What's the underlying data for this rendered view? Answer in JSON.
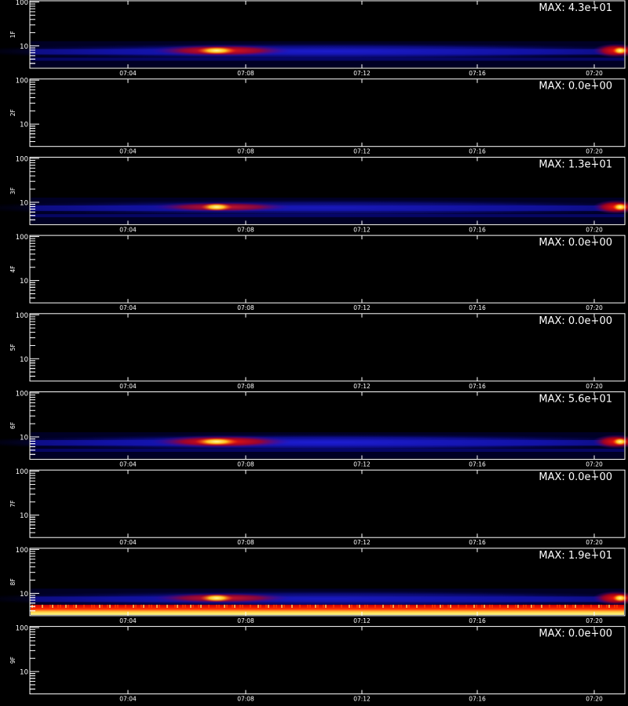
{
  "chart_data": [
    {
      "type": "heatmap",
      "ylabel": "1F",
      "max_label": "MAX: 4.3e+01",
      "y_tick_labels": [
        "100",
        "10"
      ],
      "x_tick_labels": [
        "07:04",
        "07:08",
        "07:12",
        "07:16",
        "07:20"
      ],
      "yscale": "log",
      "active": true,
      "max_value": 43
    },
    {
      "type": "heatmap",
      "ylabel": "2F",
      "max_label": "MAX: 0.0e+00",
      "y_tick_labels": [
        "100",
        "10"
      ],
      "x_tick_labels": [
        "07:04",
        "07:08",
        "07:12",
        "07:16",
        "07:20"
      ],
      "yscale": "log",
      "active": false,
      "max_value": 0
    },
    {
      "type": "heatmap",
      "ylabel": "3F",
      "max_label": "MAX: 1.3e+01",
      "y_tick_labels": [
        "100",
        "10"
      ],
      "x_tick_labels": [
        "07:04",
        "07:08",
        "07:12",
        "07:16",
        "07:20"
      ],
      "yscale": "log",
      "active": true,
      "max_value": 13
    },
    {
      "type": "heatmap",
      "ylabel": "4F",
      "max_label": "MAX: 0.0e+00",
      "y_tick_labels": [
        "100",
        "10"
      ],
      "x_tick_labels": [
        "07:04",
        "07:08",
        "07:12",
        "07:16",
        "07:20"
      ],
      "yscale": "log",
      "active": false,
      "max_value": 0
    },
    {
      "type": "heatmap",
      "ylabel": "5F",
      "max_label": "MAX: 0.0e+00",
      "y_tick_labels": [
        "100",
        "10"
      ],
      "x_tick_labels": [
        "07:04",
        "07:08",
        "07:12",
        "07:16",
        "07:20"
      ],
      "yscale": "log",
      "active": false,
      "max_value": 0
    },
    {
      "type": "heatmap",
      "ylabel": "6F",
      "max_label": "MAX: 5.6e+01",
      "y_tick_labels": [
        "100",
        "10"
      ],
      "x_tick_labels": [
        "07:04",
        "07:08",
        "07:12",
        "07:16",
        "07:20"
      ],
      "yscale": "log",
      "active": true,
      "max_value": 56
    },
    {
      "type": "heatmap",
      "ylabel": "7F",
      "max_label": "MAX: 0.0e+00",
      "y_tick_labels": [
        "100",
        "10"
      ],
      "x_tick_labels": [
        "07:04",
        "07:08",
        "07:12",
        "07:16",
        "07:20"
      ],
      "yscale": "log",
      "active": false,
      "max_value": 0
    },
    {
      "type": "heatmap",
      "ylabel": "8F",
      "max_label": "MAX: 1.9e+01",
      "y_tick_labels": [
        "100",
        "10"
      ],
      "x_tick_labels": [
        "07:04",
        "07:08",
        "07:12",
        "07:16",
        "07:20"
      ],
      "yscale": "log",
      "active": true,
      "max_value": 19,
      "bright_bottom_band": true
    },
    {
      "type": "heatmap",
      "ylabel": "9F",
      "max_label": "MAX: 0.0e+00",
      "y_tick_labels": [
        "100",
        "10"
      ],
      "x_tick_labels": [
        "07:04",
        "07:08",
        "07:12",
        "07:16",
        "07:20"
      ],
      "yscale": "log",
      "active": false,
      "max_value": 0
    }
  ],
  "colors": {
    "background": "#000000",
    "axes": "#ffffff",
    "low": "#0000c8",
    "mid": "#dc0000",
    "high": "#ffff80"
  }
}
